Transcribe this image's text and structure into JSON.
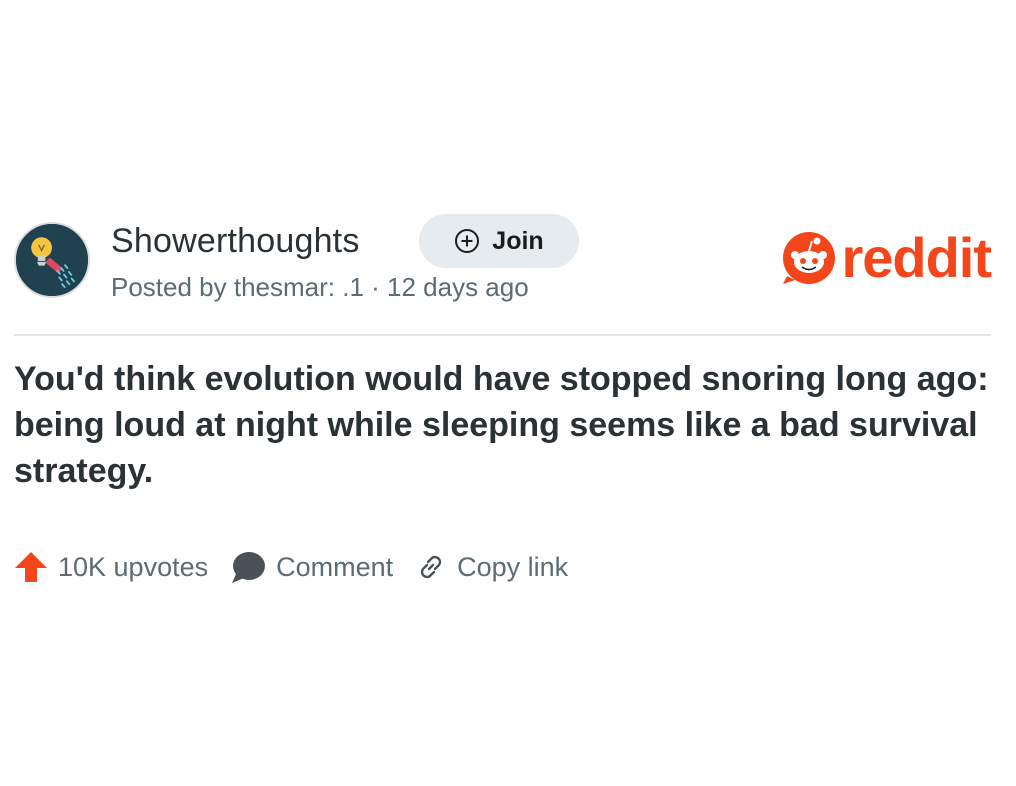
{
  "post": {
    "subreddit": "Showerthoughts",
    "join_label": "Join",
    "meta": "Posted by thesmar:   .1 · 12 days ago",
    "title": "You'd think evolution would have stopped snoring long ago: being loud at night while sleeping seems like a bad survival strategy.",
    "brand_word": "reddit"
  },
  "actions": {
    "upvotes": "10K upvotes",
    "comment": "Comment",
    "copy_link": "Copy link"
  },
  "icons": {
    "avatar": "showerthoughts-lightbulb-shower-icon",
    "join": "plus-circle-icon",
    "brand": "reddit-snoo-icon",
    "upvote": "upvote-arrow-icon",
    "comment": "comment-bubble-icon",
    "link": "link-icon"
  },
  "colors": {
    "brand": "#f4461b",
    "upvote": "#f4461b",
    "text_primary": "#2a3236",
    "text_secondary": "#5c6c74",
    "join_bg": "#e5ebee",
    "avatar_bg": "#1f4150"
  }
}
